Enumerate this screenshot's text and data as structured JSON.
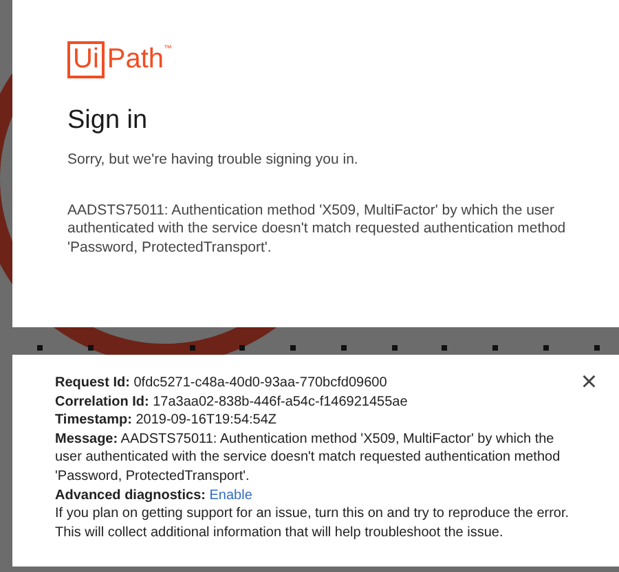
{
  "logo": {
    "boxed": "Ui",
    "rest": "Path",
    "mark": "™"
  },
  "title": "Sign in",
  "subtitle": "Sorry, but we're having trouble signing you in.",
  "error": "AADSTS75011: Authentication method 'X509, MultiFactor' by which the user authenticated with the service doesn't match requested authentication method 'Password, ProtectedTransport'.",
  "details": {
    "close": "×",
    "rows": [
      {
        "text": "**Request Id:** 0fdc5271-c48a-40d0-93aa-770bcfd09600"
      },
      {
        "text": "**Correlation Id:** 17a3aa02-838b-446f-a54c-f146921455ae"
      },
      {
        "text": "**Timestamp:** 2019-09-16T19:54:54Z"
      },
      {
        "text": "**Message:** AADSTS75011: Authentication method 'X509, MultiFactor' by which the user authenticated with the service doesn't match requested authentication method 'Password, ProtectedTransport'."
      }
    ],
    "diagnostics": {
      "label": "Advanced diagnostics:",
      "link": "Enable"
    },
    "help": "If you plan on getting support for an issue, turn this on and try to reproduce the error. This will collect additional information that will help troubleshoot the issue."
  }
}
